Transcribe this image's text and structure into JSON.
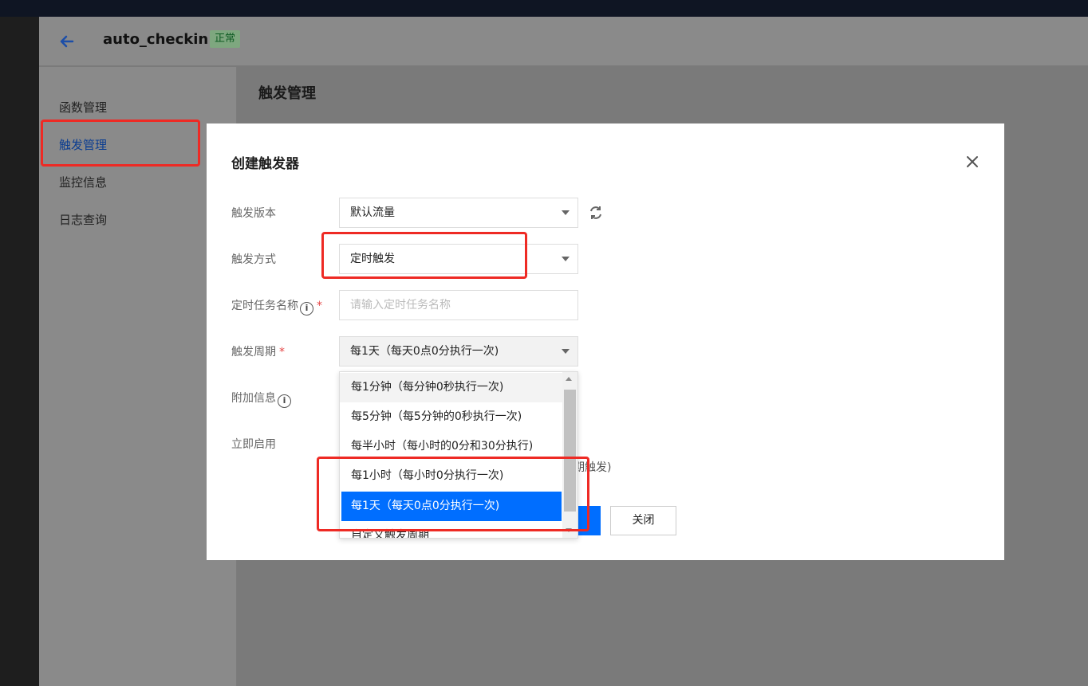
{
  "header": {
    "back_icon": "arrow-left-icon",
    "function_name": "auto_checkin",
    "status": "正常"
  },
  "sidenav": {
    "items": [
      {
        "label": "函数管理"
      },
      {
        "label": "触发管理"
      },
      {
        "label": "监控信息"
      },
      {
        "label": "日志查询"
      }
    ],
    "active_index": 1
  },
  "content": {
    "title": "触发管理"
  },
  "modal": {
    "title": "创建触发器",
    "close_icon": "close-icon",
    "fields": {
      "version": {
        "label": "触发版本",
        "value": "默认流量"
      },
      "method": {
        "label": "触发方式",
        "value": "定时触发"
      },
      "task_name": {
        "label": "定时任务名称",
        "placeholder": "请输入定时任务名称"
      },
      "period": {
        "label": "触发周期",
        "value": "每1天（每天0点0分执行一次)"
      },
      "extra_info": {
        "label": "附加信息"
      },
      "enable_now": {
        "label": "立即启用"
      }
    },
    "hint_fragment": "期触发)",
    "close_button": "关闭"
  },
  "dropdown": {
    "options": [
      "每1分钟（每分钟0秒执行一次)",
      "每5分钟（每5分钟的0秒执行一次)",
      "每半小时（每小时的0分和30分执行)",
      "每1小时（每小时0分执行一次)",
      "每1天（每天0点0分执行一次)",
      "自定义触发周期"
    ],
    "hover_index": 0,
    "selected_index": 4
  },
  "colors": {
    "primary": "#006eff",
    "highlight": "#ee2a24"
  }
}
